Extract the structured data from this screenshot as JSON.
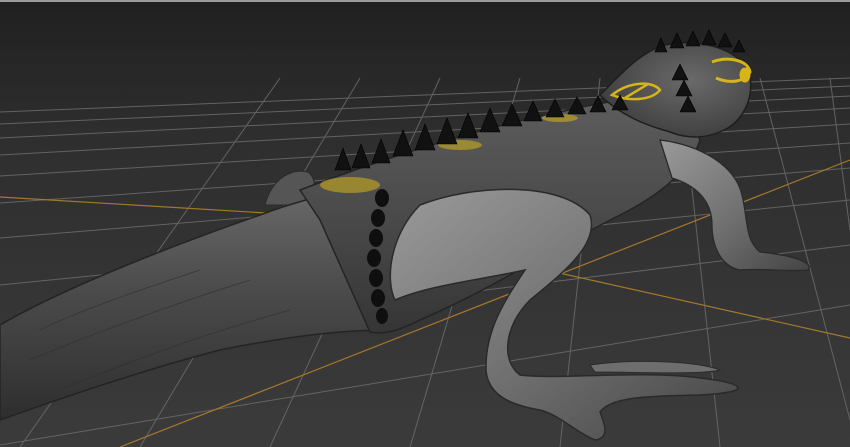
{
  "app": {
    "viewport_name": "perspective-viewport",
    "model": "lizard-sculpt"
  },
  "colors": {
    "viewport_top": "#202020",
    "viewport_bottom": "#3b3b3b",
    "grid_line": "#6c6c6c",
    "grid_axis": "#a5782c",
    "body_dark": "#3a3a3a",
    "body_mid": "#575757",
    "body_light": "#8a8a8a",
    "spike": "#111111",
    "accent_yellow": "#d7b41a"
  },
  "icons": {
    "spikes": "spike-row",
    "markings": "yellow-eye-marking"
  }
}
